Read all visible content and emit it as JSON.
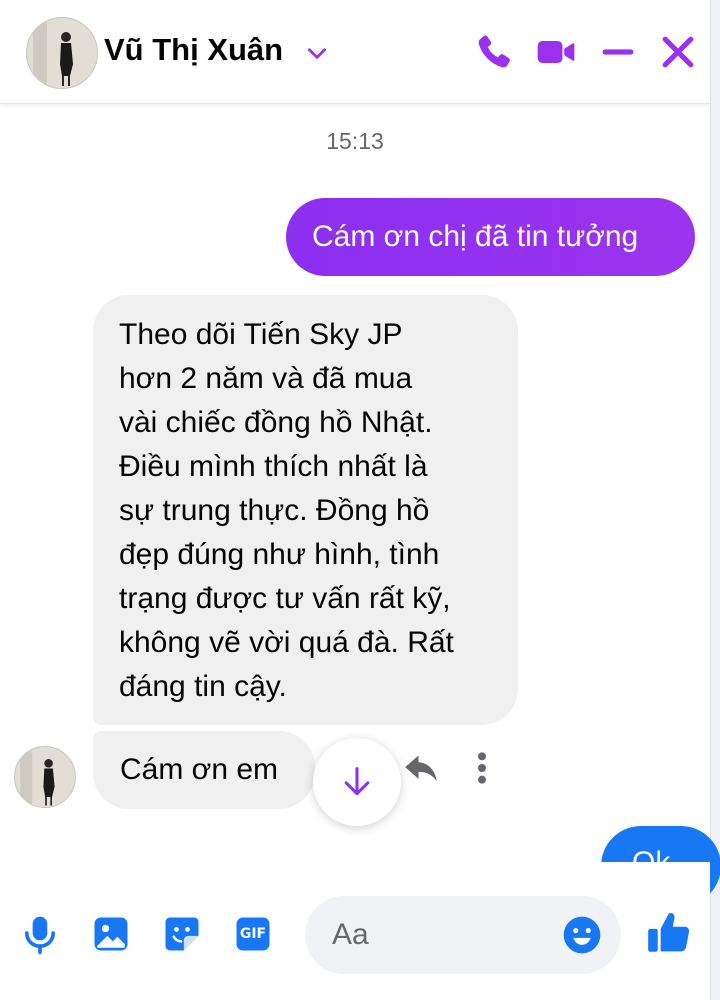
{
  "header": {
    "contact_name": "Vũ Thị Xuân",
    "icons": [
      "chevron-down-icon",
      "phone-icon",
      "video-call-icon",
      "minimize-icon",
      "close-icon"
    ]
  },
  "conversation": {
    "timestamp": "15:13",
    "outgoing_message": "Cám ơn chị đã tin tưởng",
    "incoming_long_message_lines": [
      "Theo dõi Tiến Sky JP",
      "hơn 2 năm và đã mua",
      "vài chiếc đồng hồ Nhật.",
      "Điều mình thích nhất là",
      "sự trung thực. Đồng hồ",
      "đẹp đúng như hình, tình",
      "trạng được tư vấn rất kỹ,",
      "không vẽ vời quá đà. Rất",
      "đáng tin cậy."
    ],
    "incoming_short_message": "Cám ơn em",
    "partial_outgoing_text": "Ok"
  },
  "composer": {
    "placeholder": "Aa",
    "tools": [
      "microphone-icon",
      "photo-icon",
      "sticker-icon",
      "gif-icon"
    ],
    "gif_label": "GIF"
  },
  "colors": {
    "accent": "#9b30ef",
    "outgoing_bubble": "#8b2ff0",
    "incoming_bubble": "#f0f0f0",
    "composer_icons": "#1877f2"
  }
}
